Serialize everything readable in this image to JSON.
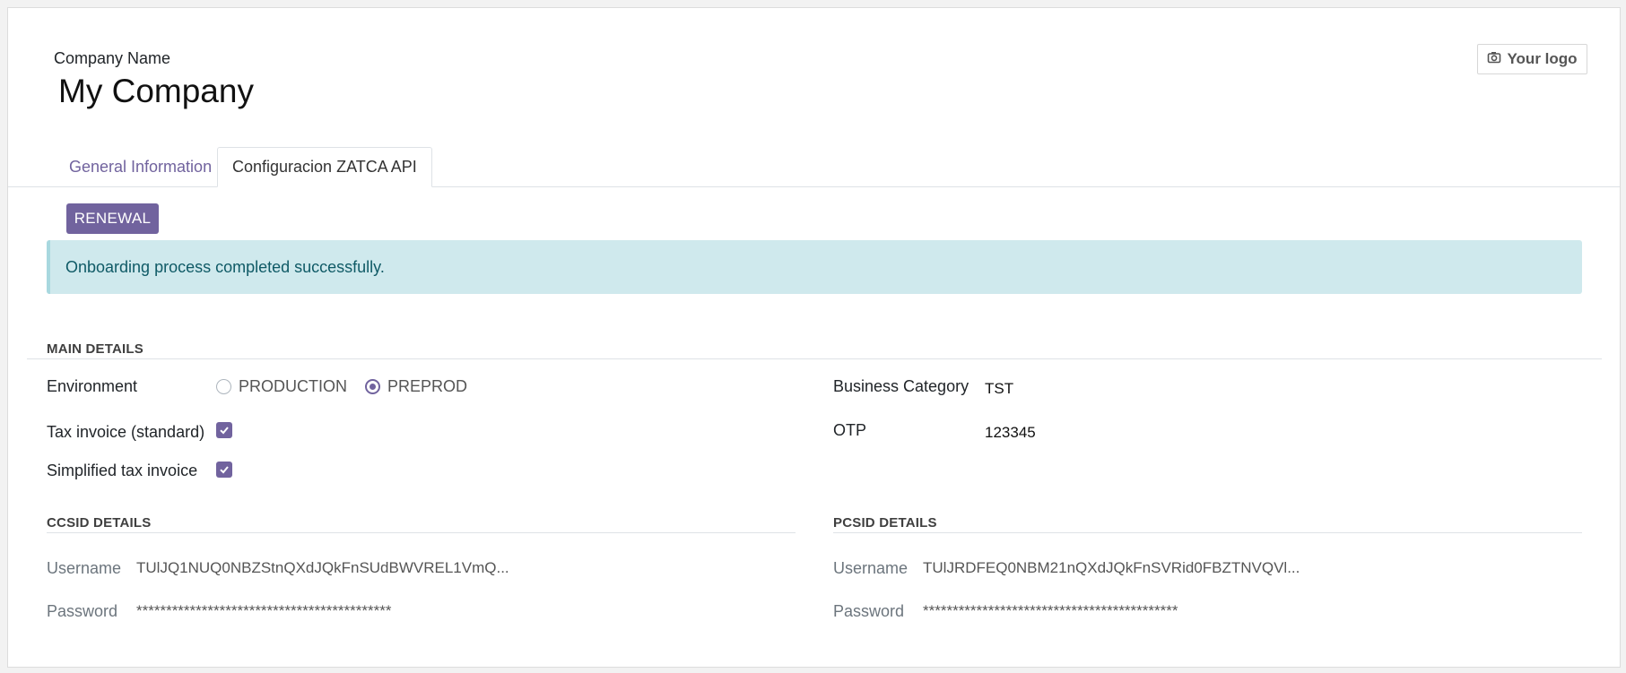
{
  "header": {
    "company_label": "Company Name",
    "company_name": "My Company",
    "logo_label": "Your logo",
    "logo_icon": "camera-icon"
  },
  "tabs": [
    {
      "label": "General Information",
      "active": false
    },
    {
      "label": "Configuracion ZATCA API",
      "active": true
    }
  ],
  "actions": {
    "renewal_label": "RENEWAL"
  },
  "alert": {
    "message": "Onboarding process completed successfully."
  },
  "main_details": {
    "title": "MAIN DETAILS",
    "environment_label": "Environment",
    "environment_options": [
      "PRODUCTION",
      "PREPROD"
    ],
    "environment_selected": "PREPROD",
    "tax_invoice_label": "Tax invoice (standard)",
    "tax_invoice_checked": true,
    "simplified_label": "Simplified tax invoice",
    "simplified_checked": true,
    "business_category_label": "Business Category",
    "business_category_value": "TST",
    "otp_label": "OTP",
    "otp_value": "123345"
  },
  "ccsid": {
    "title": "CCSID DETAILS",
    "username_label": "Username",
    "username_value": "TUlJQ1NUQ0NBZStnQXdJQkFnSUdBWVREL1VmQ...",
    "password_label": "Password",
    "password_value": "*******************************************"
  },
  "pcsid": {
    "title": "PCSID DETAILS",
    "username_label": "Username",
    "username_value": "TUlJRDFEQ0NBM21nQXdJQkFnSVRid0FBZTNVQVl...",
    "password_label": "Password",
    "password_value": "*******************************************"
  },
  "colors": {
    "accent": "#71639e",
    "alert_bg": "#cfe9ed",
    "alert_text": "#0f5a66"
  }
}
